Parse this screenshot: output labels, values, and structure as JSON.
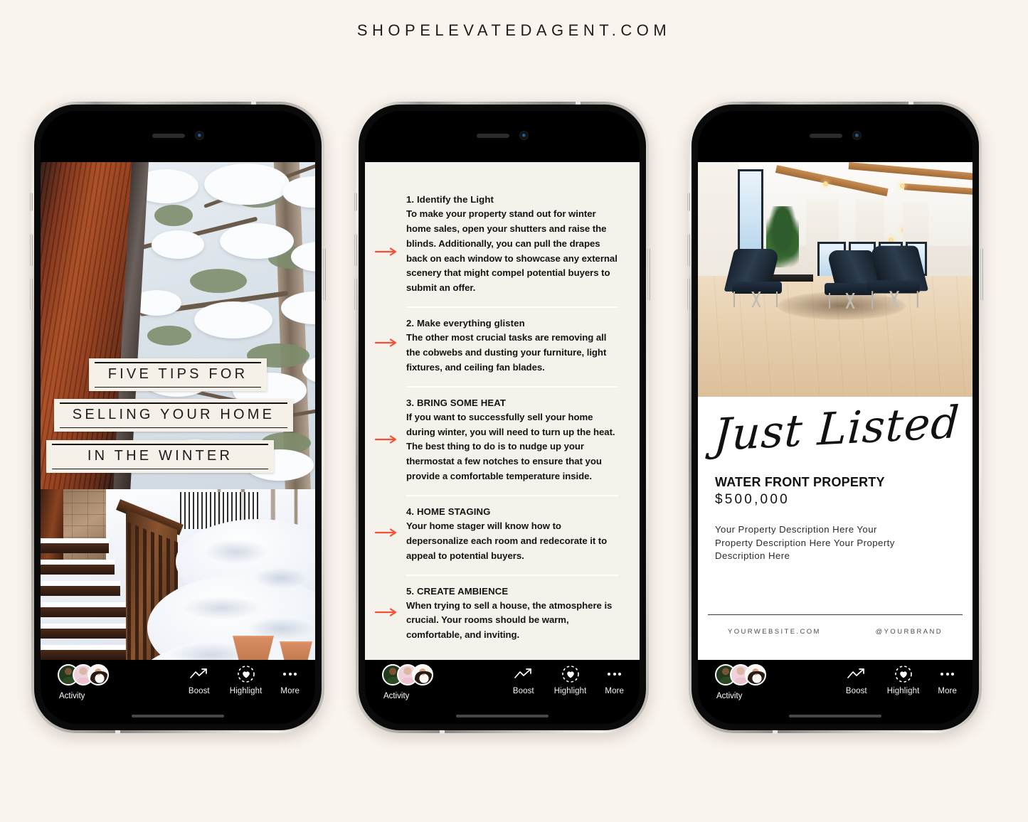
{
  "header": {
    "title": "SHOPELEVATEDAGENT.COM"
  },
  "toolbar": {
    "activity_label": "Activity",
    "boost_label": "Boost",
    "highlight_label": "Highlight",
    "more_label": "More"
  },
  "phone1": {
    "title_lines": [
      "FIVE TIPS FOR",
      "SELLING YOUR HOME",
      "IN THE WINTER"
    ],
    "photo_alt": "snow covered pine tree through a cabin window and snowy wooden stairs"
  },
  "phone2": {
    "tips": [
      {
        "heading": "1. Identify the Light",
        "body": "To make your property stand out for winter home sales, open your shutters and raise the blinds. Additionally, you can pull the drapes back on each window to showcase any external scenery that might compel potential buyers to submit an offer."
      },
      {
        "heading": "2. Make everything glisten",
        "body": "The other most crucial tasks are removing all the cobwebs and dusting your furniture, light fixtures, and ceiling fan blades."
      },
      {
        "heading": "3. BRING SOME HEAT",
        "body": "If you want to successfully sell your home during winter, you will need to turn up the heat. The best thing to do is to nudge up your thermostat a few notches to ensure that you provide a comfortable temperature inside."
      },
      {
        "heading": "4. HOME STAGING",
        "body": "Your home stager will know how to depersonalize each room and redecorate it to appeal to potential buyers."
      },
      {
        "heading": "5. CREATE AMBIENCE",
        "body": "When trying to sell a house, the atmosphere is crucial. Your rooms should be warm, comfortable, and inviting."
      }
    ],
    "arrow_color": "#ef5236"
  },
  "phone3": {
    "script_title": "Just Listed",
    "property_name": "WATER FRONT PROPERTY",
    "price": "$500,000",
    "description": "Your Property Description Here Your Property Description Here Your Property Description Here",
    "website": "YOURWEBSITE.COM",
    "handle": "@YOURBRAND",
    "photo_alt": "modern living room with leather lounge chairs and light wood floors"
  },
  "colors": {
    "page_background": "#faf4ee",
    "panel_cream": "#f5f1eb",
    "accent_red": "#ef5236",
    "text_dark": "#141414"
  }
}
